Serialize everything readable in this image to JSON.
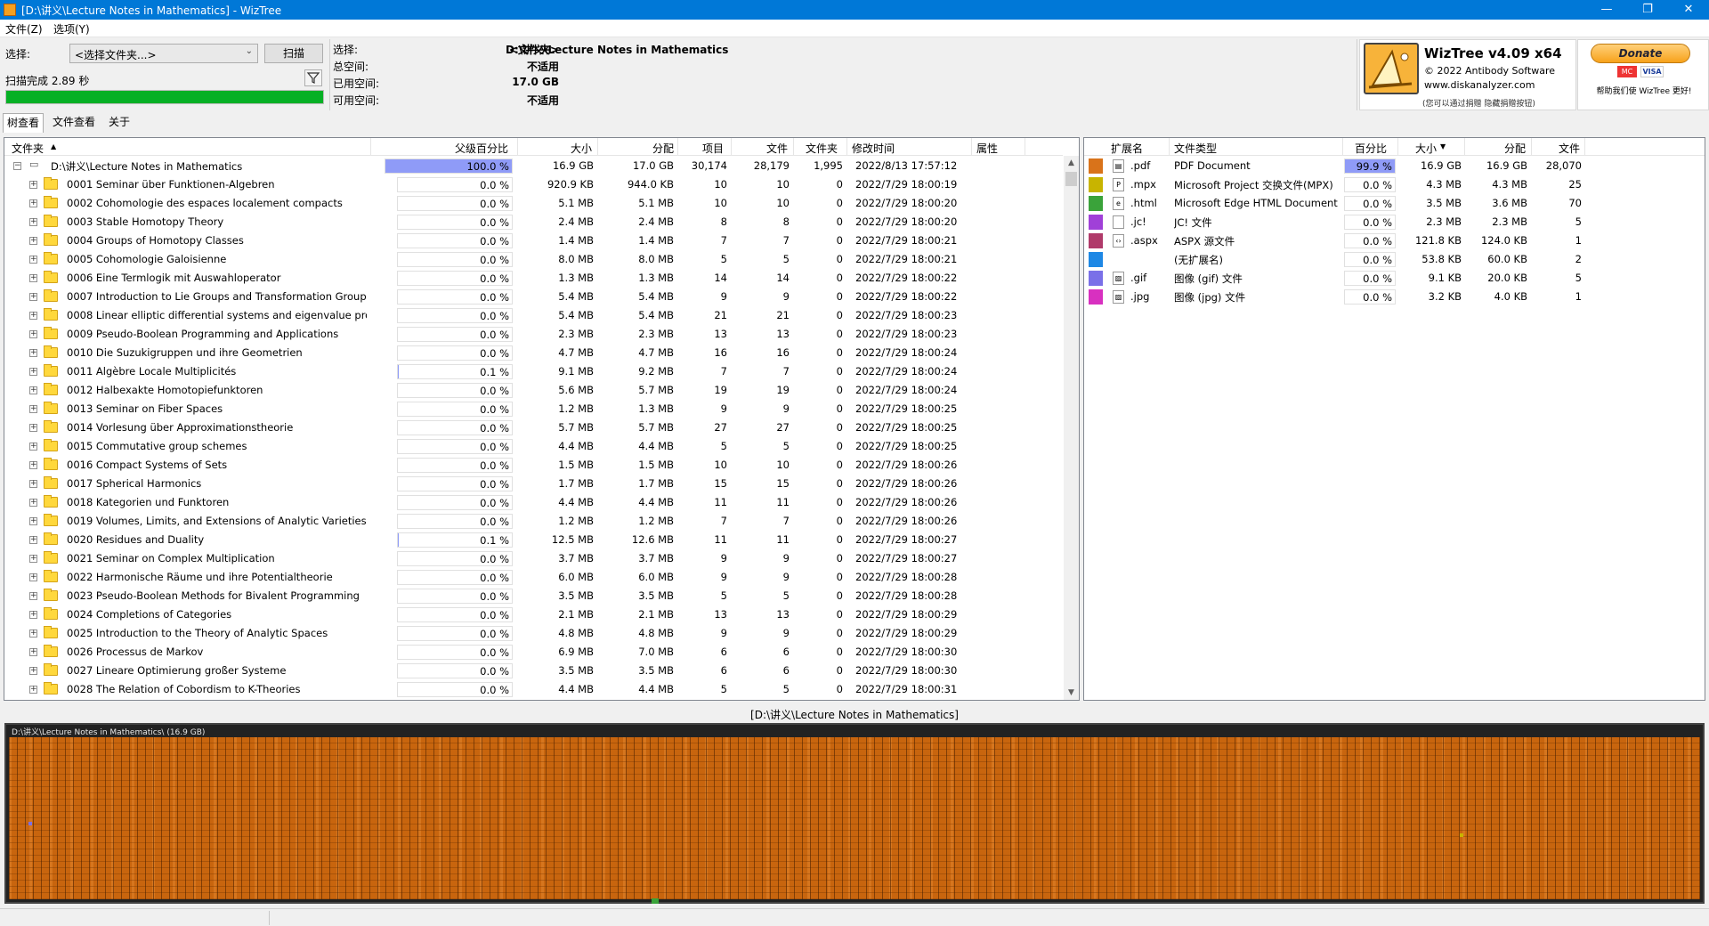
{
  "window": {
    "title": "[D:\\讲义\\Lecture Notes in Mathematics]  - WizTree",
    "minimize": "—",
    "maximize": "❐",
    "close": "✕"
  },
  "menu": {
    "file": "文件(Z)",
    "options": "选项(Y)"
  },
  "controls": {
    "select_label": "选择:",
    "folder_select_value": "<选择文件夹...>",
    "scan_button": "扫描",
    "scan_status": "扫描完成 2.89 秒",
    "progress_fraction": 1.0
  },
  "info": {
    "select_label": "选择:",
    "select_value_tag": "<文件夹>",
    "select_path": "D:\\讲义\\Lecture Notes in Mathematics",
    "total_label": "总空间:",
    "total_value": "不适用",
    "used_label": "已用空间:",
    "used_value": "17.0 GB",
    "free_label": "可用空间:",
    "free_value": "不适用"
  },
  "brand": {
    "name": "WizTree v4.09 x64",
    "copyright": "© 2022 Antibody Software",
    "site": "www.diskanalyzer.com",
    "note": "(您可以通过捐赠 隐藏捐赠按钮)"
  },
  "donate": {
    "button": "Donate",
    "card1": "MC",
    "card2": "VISA",
    "tagline": "帮助我们使 WizTree 更好!"
  },
  "tabs": [
    {
      "label": "树查看",
      "active": true
    },
    {
      "label": "文件查看",
      "active": false
    },
    {
      "label": "关于",
      "active": false
    }
  ],
  "tree": {
    "headers": {
      "folder": "文件夹",
      "parent_pct": "父级百分比",
      "size": "大小",
      "allocated": "分配",
      "items": "项目",
      "files": "文件",
      "folders": "文件夹",
      "modified": "修改时间",
      "attributes": "属性"
    },
    "root": {
      "name": "D:\\讲义\\Lecture Notes in Mathematics",
      "pct": "100.0 %",
      "pct_value": 100.0,
      "size": "16.9 GB",
      "alloc": "17.0 GB",
      "items": "30,174",
      "files": "28,179",
      "folders": "1,995",
      "modified": "2022/8/13 17:57:12"
    },
    "rows": [
      {
        "name": "0001 Seminar über Funktionen-Algebren",
        "pct": "0.0 %",
        "size": "920.9 KB",
        "alloc": "944.0 KB",
        "items": "10",
        "files": "10",
        "folders": "0",
        "modified": "2022/7/29 18:00:19"
      },
      {
        "name": "0002 Cohomologie des espaces localement compacts",
        "pct": "0.0 %",
        "size": "5.1 MB",
        "alloc": "5.1 MB",
        "items": "10",
        "files": "10",
        "folders": "0",
        "modified": "2022/7/29 18:00:20"
      },
      {
        "name": "0003 Stable Homotopy Theory",
        "pct": "0.0 %",
        "size": "2.4 MB",
        "alloc": "2.4 MB",
        "items": "8",
        "files": "8",
        "folders": "0",
        "modified": "2022/7/29 18:00:20"
      },
      {
        "name": "0004 Groups of Homotopy Classes",
        "pct": "0.0 %",
        "size": "1.4 MB",
        "alloc": "1.4 MB",
        "items": "7",
        "files": "7",
        "folders": "0",
        "modified": "2022/7/29 18:00:21"
      },
      {
        "name": "0005 Cohomologie Galoisienne",
        "pct": "0.0 %",
        "size": "8.0 MB",
        "alloc": "8.0 MB",
        "items": "5",
        "files": "5",
        "folders": "0",
        "modified": "2022/7/29 18:00:21"
      },
      {
        "name": "0006 Eine Termlogik mit Auswahloperator",
        "pct": "0.0 %",
        "size": "1.3 MB",
        "alloc": "1.3 MB",
        "items": "14",
        "files": "14",
        "folders": "0",
        "modified": "2022/7/29 18:00:22"
      },
      {
        "name": "0007 Introduction to Lie Groups and Transformation Groups",
        "pct": "0.0 %",
        "size": "5.4 MB",
        "alloc": "5.4 MB",
        "items": "9",
        "files": "9",
        "folders": "0",
        "modified": "2022/7/29 18:00:22"
      },
      {
        "name": "0008 Linear elliptic differential systems and eigenvalue problems",
        "pct": "0.0 %",
        "size": "5.4 MB",
        "alloc": "5.4 MB",
        "items": "21",
        "files": "21",
        "folders": "0",
        "modified": "2022/7/29 18:00:23"
      },
      {
        "name": "0009 Pseudo-Boolean Programming and Applications",
        "pct": "0.0 %",
        "size": "2.3 MB",
        "alloc": "2.3 MB",
        "items": "13",
        "files": "13",
        "folders": "0",
        "modified": "2022/7/29 18:00:23"
      },
      {
        "name": "0010 Die Suzukigruppen und ihre Geometrien",
        "pct": "0.0 %",
        "size": "4.7 MB",
        "alloc": "4.7 MB",
        "items": "16",
        "files": "16",
        "folders": "0",
        "modified": "2022/7/29 18:00:24"
      },
      {
        "name": "0011 Algèbre Locale Multiplicités",
        "pct": "0.1 %",
        "size": "9.1 MB",
        "alloc": "9.2 MB",
        "items": "7",
        "files": "7",
        "folders": "0",
        "modified": "2022/7/29 18:00:24"
      },
      {
        "name": "0012 Halbexakte Homotopiefunktoren",
        "pct": "0.0 %",
        "size": "5.6 MB",
        "alloc": "5.7 MB",
        "items": "19",
        "files": "19",
        "folders": "0",
        "modified": "2022/7/29 18:00:24"
      },
      {
        "name": "0013 Seminar on Fiber Spaces",
        "pct": "0.0 %",
        "size": "1.2 MB",
        "alloc": "1.3 MB",
        "items": "9",
        "files": "9",
        "folders": "0",
        "modified": "2022/7/29 18:00:25"
      },
      {
        "name": "0014 Vorlesung über Approximationstheorie",
        "pct": "0.0 %",
        "size": "5.7 MB",
        "alloc": "5.7 MB",
        "items": "27",
        "files": "27",
        "folders": "0",
        "modified": "2022/7/29 18:00:25"
      },
      {
        "name": "0015 Commutative group schemes",
        "pct": "0.0 %",
        "size": "4.4 MB",
        "alloc": "4.4 MB",
        "items": "5",
        "files": "5",
        "folders": "0",
        "modified": "2022/7/29 18:00:25"
      },
      {
        "name": "0016 Compact Systems of Sets",
        "pct": "0.0 %",
        "size": "1.5 MB",
        "alloc": "1.5 MB",
        "items": "10",
        "files": "10",
        "folders": "0",
        "modified": "2022/7/29 18:00:26"
      },
      {
        "name": "0017 Spherical Harmonics",
        "pct": "0.0 %",
        "size": "1.7 MB",
        "alloc": "1.7 MB",
        "items": "15",
        "files": "15",
        "folders": "0",
        "modified": "2022/7/29 18:00:26"
      },
      {
        "name": "0018 Kategorien und Funktoren",
        "pct": "0.0 %",
        "size": "4.4 MB",
        "alloc": "4.4 MB",
        "items": "11",
        "files": "11",
        "folders": "0",
        "modified": "2022/7/29 18:00:26"
      },
      {
        "name": "0019 Volumes, Limits, and Extensions of Analytic Varieties",
        "pct": "0.0 %",
        "size": "1.2 MB",
        "alloc": "1.2 MB",
        "items": "7",
        "files": "7",
        "folders": "0",
        "modified": "2022/7/29 18:00:26"
      },
      {
        "name": "0020 Residues and Duality",
        "pct": "0.1 %",
        "size": "12.5 MB",
        "alloc": "12.6 MB",
        "items": "11",
        "files": "11",
        "folders": "0",
        "modified": "2022/7/29 18:00:27"
      },
      {
        "name": "0021 Seminar on Complex Multiplication",
        "pct": "0.0 %",
        "size": "3.7 MB",
        "alloc": "3.7 MB",
        "items": "9",
        "files": "9",
        "folders": "0",
        "modified": "2022/7/29 18:00:27"
      },
      {
        "name": "0022 Harmonische Räume und ihre Potentialtheorie",
        "pct": "0.0 %",
        "size": "6.0 MB",
        "alloc": "6.0 MB",
        "items": "9",
        "files": "9",
        "folders": "0",
        "modified": "2022/7/29 18:00:28"
      },
      {
        "name": "0023 Pseudo-Boolean Methods for Bivalent Programming",
        "pct": "0.0 %",
        "size": "3.5 MB",
        "alloc": "3.5 MB",
        "items": "5",
        "files": "5",
        "folders": "0",
        "modified": "2022/7/29 18:00:28"
      },
      {
        "name": "0024 Completions of Categories",
        "pct": "0.0 %",
        "size": "2.1 MB",
        "alloc": "2.1 MB",
        "items": "13",
        "files": "13",
        "folders": "0",
        "modified": "2022/7/29 18:00:29"
      },
      {
        "name": "0025 Introduction to the Theory of Analytic Spaces",
        "pct": "0.0 %",
        "size": "4.8 MB",
        "alloc": "4.8 MB",
        "items": "9",
        "files": "9",
        "folders": "0",
        "modified": "2022/7/29 18:00:29"
      },
      {
        "name": "0026 Processus de Markov",
        "pct": "0.0 %",
        "size": "6.9 MB",
        "alloc": "7.0 MB",
        "items": "6",
        "files": "6",
        "folders": "0",
        "modified": "2022/7/29 18:00:30"
      },
      {
        "name": "0027 Lineare Optimierung großer Systeme",
        "pct": "0.0 %",
        "size": "3.5 MB",
        "alloc": "3.5 MB",
        "items": "6",
        "files": "6",
        "folders": "0",
        "modified": "2022/7/29 18:00:30"
      },
      {
        "name": "0028 The Relation of Cobordism to K-Theories",
        "pct": "0.0 %",
        "size": "4.4 MB",
        "alloc": "4.4 MB",
        "items": "5",
        "files": "5",
        "folders": "0",
        "modified": "2022/7/29 18:00:31"
      }
    ]
  },
  "extensions": {
    "headers": {
      "ext": "扩展名",
      "type": "文件类型",
      "pct": "百分比",
      "size": "大小",
      "alloc": "分配",
      "files": "文件"
    },
    "rows": [
      {
        "color": "#d9731a",
        "icon": "pdf-icon",
        "glyph": "▤",
        "ext": ".pdf",
        "type": "PDF Document",
        "pct": "99.9 %",
        "pct_value": 99.9,
        "size": "16.9 GB",
        "alloc": "16.9 GB",
        "files": "28,070"
      },
      {
        "color": "#c8b400",
        "icon": "project-icon",
        "glyph": "P",
        "ext": ".mpx",
        "type": "Microsoft Project 交换文件(MPX)",
        "pct": "0.0 %",
        "pct_value": 0,
        "size": "4.3 MB",
        "alloc": "4.3 MB",
        "files": "25"
      },
      {
        "color": "#3aa33a",
        "icon": "edge-icon",
        "glyph": "e",
        "ext": ".html",
        "type": "Microsoft Edge HTML Document",
        "pct": "0.0 %",
        "pct_value": 0,
        "size": "3.5 MB",
        "alloc": "3.6 MB",
        "files": "70"
      },
      {
        "color": "#a040d8",
        "icon": "file-icon",
        "glyph": "",
        "ext": ".jc!",
        "type": "JC! 文件",
        "pct": "0.0 %",
        "pct_value": 0,
        "size": "2.3 MB",
        "alloc": "2.3 MB",
        "files": "5"
      },
      {
        "color": "#b03a6a",
        "icon": "aspx-icon",
        "glyph": "‹›",
        "ext": ".aspx",
        "type": "ASPX 源文件",
        "pct": "0.0 %",
        "pct_value": 0,
        "size": "121.8 KB",
        "alloc": "124.0 KB",
        "files": "1"
      },
      {
        "color": "#1e88e5",
        "icon": "",
        "glyph": "",
        "ext": "",
        "type": "(无扩展名)",
        "pct": "0.0 %",
        "pct_value": 0,
        "size": "53.8 KB",
        "alloc": "60.0 KB",
        "files": "2"
      },
      {
        "color": "#7a70e8",
        "icon": "image-icon",
        "glyph": "▨",
        "ext": ".gif",
        "type": "图像 (gif) 文件",
        "pct": "0.0 %",
        "pct_value": 0,
        "size": "9.1 KB",
        "alloc": "20.0 KB",
        "files": "5"
      },
      {
        "color": "#d830c0",
        "icon": "image-icon",
        "glyph": "▨",
        "ext": ".jpg",
        "type": "图像 (jpg) 文件",
        "pct": "0.0 %",
        "pct_value": 0,
        "size": "3.2 KB",
        "alloc": "4.0 KB",
        "files": "1"
      }
    ]
  },
  "treemap": {
    "path_label": "[D:\\讲义\\Lecture Notes in Mathematics]",
    "inner_title": "D:\\讲义\\Lecture Notes in Mathematics\\ (16.9 GB)"
  }
}
